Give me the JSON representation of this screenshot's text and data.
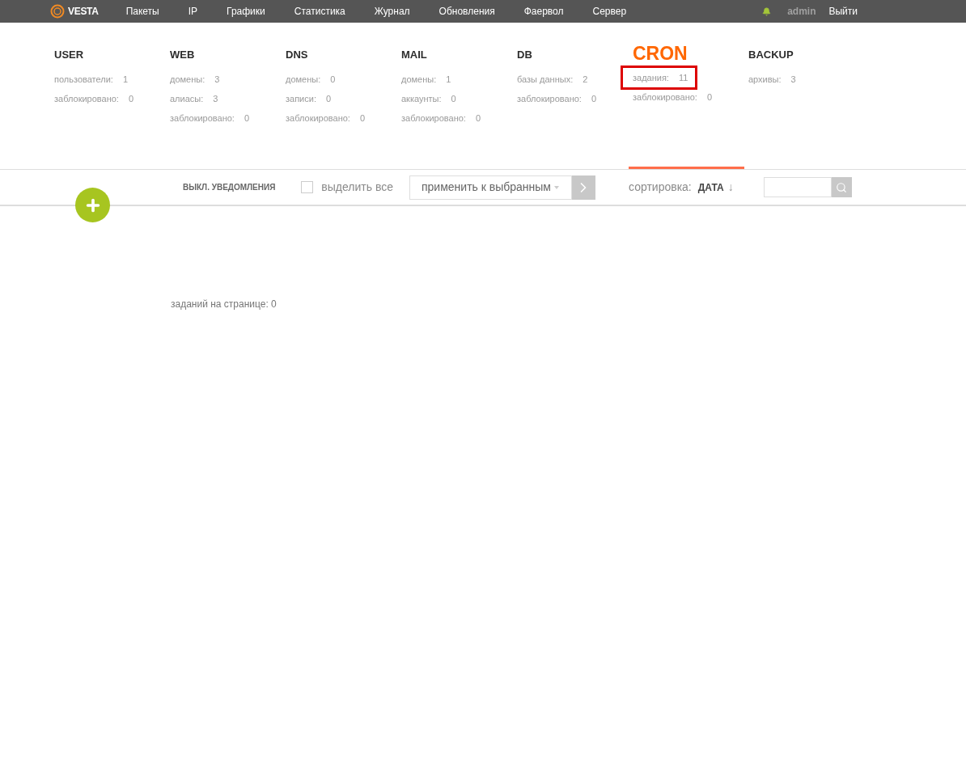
{
  "logo": {
    "text": "VESTA"
  },
  "nav": [
    {
      "label": "Пакеты"
    },
    {
      "label": "IP"
    },
    {
      "label": "Графики"
    },
    {
      "label": "Статистика"
    },
    {
      "label": "Журнал"
    },
    {
      "label": "Обновления"
    },
    {
      "label": "Фаервол"
    },
    {
      "label": "Сервер"
    }
  ],
  "user": {
    "name": "admin",
    "logout": "Выйти"
  },
  "sections": [
    {
      "title": "USER",
      "selected": false,
      "stats": [
        {
          "label": "пользователи:",
          "value": "1",
          "highlighted": false
        },
        {
          "label": "заблокировано:",
          "value": "0",
          "highlighted": false
        }
      ]
    },
    {
      "title": "WEB",
      "selected": false,
      "stats": [
        {
          "label": "домены:",
          "value": "3",
          "highlighted": false
        },
        {
          "label": "алиасы:",
          "value": "3",
          "highlighted": false
        },
        {
          "label": "заблокировано:",
          "value": "0",
          "highlighted": false
        }
      ]
    },
    {
      "title": "DNS",
      "selected": false,
      "stats": [
        {
          "label": "домены:",
          "value": "0",
          "highlighted": false
        },
        {
          "label": "записи:",
          "value": "0",
          "highlighted": false
        },
        {
          "label": "заблокировано:",
          "value": "0",
          "highlighted": false
        }
      ]
    },
    {
      "title": "MAIL",
      "selected": false,
      "stats": [
        {
          "label": "домены:",
          "value": "1",
          "highlighted": false
        },
        {
          "label": "аккаунты:",
          "value": "0",
          "highlighted": false
        },
        {
          "label": "заблокировано:",
          "value": "0",
          "highlighted": false
        }
      ]
    },
    {
      "title": "DB",
      "selected": false,
      "stats": [
        {
          "label": "базы данных:",
          "value": "2",
          "highlighted": false
        },
        {
          "label": "заблокировано:",
          "value": "0",
          "highlighted": false
        }
      ]
    },
    {
      "title": "CRON",
      "selected": true,
      "stats": [
        {
          "label": "задания:",
          "value": "11",
          "highlighted": true
        },
        {
          "label": "заблокировано:",
          "value": "0",
          "highlighted": false
        }
      ]
    },
    {
      "title": "BACKUP",
      "selected": false,
      "stats": [
        {
          "label": "архивы:",
          "value": "3",
          "highlighted": false
        }
      ]
    }
  ],
  "toolbar": {
    "notifications": "ВЫКЛ. УВЕДОМЛЕНИЯ",
    "select_all": {
      "label": "выделить все",
      "checked": false
    },
    "bulk_action": "применить к выбранным",
    "sort_label": "сортировка:",
    "sort_value": "ДАТА",
    "sort_arrow": "↓"
  },
  "footer": {
    "count": "заданий на странице: 0"
  }
}
